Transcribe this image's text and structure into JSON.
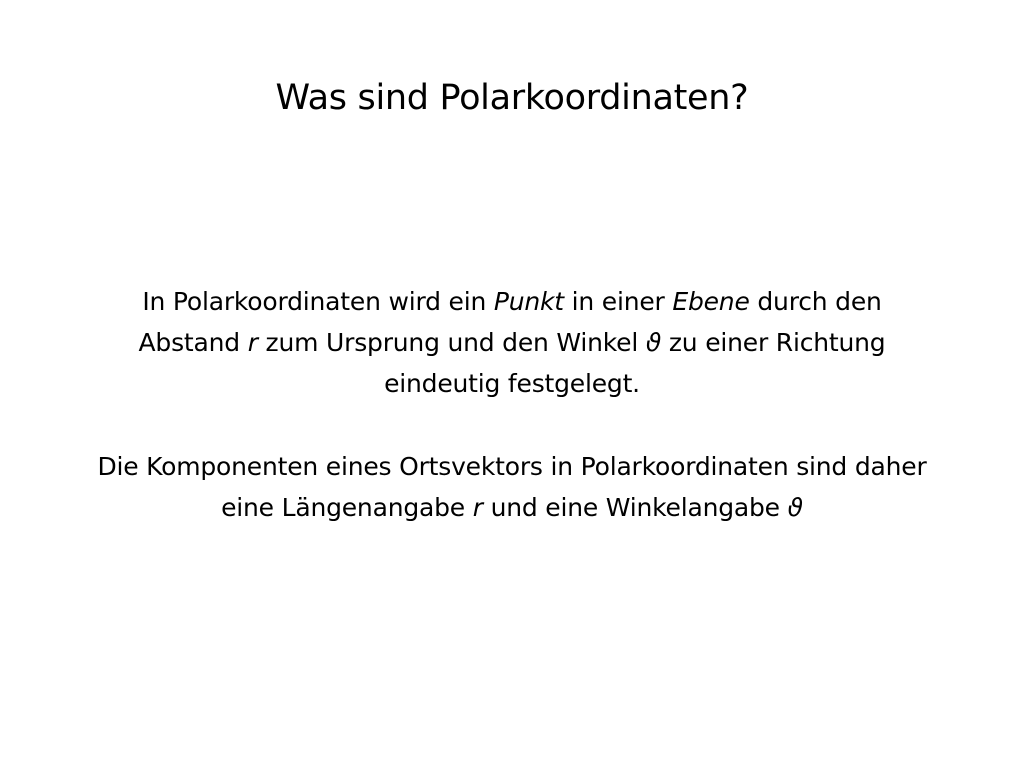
{
  "slide": {
    "title": "Was sind Polarkoordinaten?",
    "paragraph1": {
      "line1": {
        "a": "In Polarkoordinaten wird ein ",
        "b": "Punkt",
        "c": " in einer ",
        "d": "Ebene",
        "e": " durch den"
      },
      "line2": {
        "a": "Abstand ",
        "b": "r",
        "c": " zum Ursprung und den Winkel ",
        "d": "ϑ",
        "e": " zu einer Richtung"
      },
      "line3": "eindeutig festgelegt."
    },
    "paragraph2": {
      "line1": "Die Komponenten eines Ortsvektors in Polarkoordinaten sind daher",
      "line2": {
        "a": "eine Längenangabe ",
        "b": "r",
        "c": " und eine Winkelangabe ",
        "d": "ϑ"
      }
    }
  }
}
